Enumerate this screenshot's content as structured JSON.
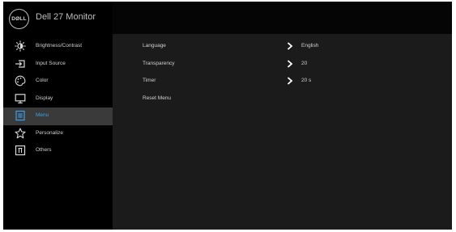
{
  "header": {
    "logo_text": "DØLL",
    "title": "Dell 27 Monitor"
  },
  "sidebar": {
    "items": [
      {
        "label": "Brightness/Contrast",
        "icon": "brightness-icon",
        "active": false
      },
      {
        "label": "Input Source",
        "icon": "input-source-icon",
        "active": false
      },
      {
        "label": "Color",
        "icon": "color-icon",
        "active": false
      },
      {
        "label": "Display",
        "icon": "display-icon",
        "active": false
      },
      {
        "label": "Menu",
        "icon": "menu-icon",
        "active": true
      },
      {
        "label": "Personalize",
        "icon": "star-icon",
        "active": false
      },
      {
        "label": "Others",
        "icon": "others-icon",
        "active": false
      }
    ]
  },
  "menu_settings": {
    "rows": [
      {
        "label": "Language",
        "value": "English",
        "has_submenu": true
      },
      {
        "label": "Transparency",
        "value": "20",
        "has_submenu": true
      },
      {
        "label": "Timer",
        "value": "20 s",
        "has_submenu": true
      },
      {
        "label": "Reset Menu",
        "value": "",
        "has_submenu": false
      }
    ]
  },
  "colors": {
    "accent": "#3aa0e8",
    "panel_background": "#1b1b1b",
    "sidebar_background": "#000000",
    "active_background": "#3a3a3a",
    "text": "#d0d0d0"
  }
}
